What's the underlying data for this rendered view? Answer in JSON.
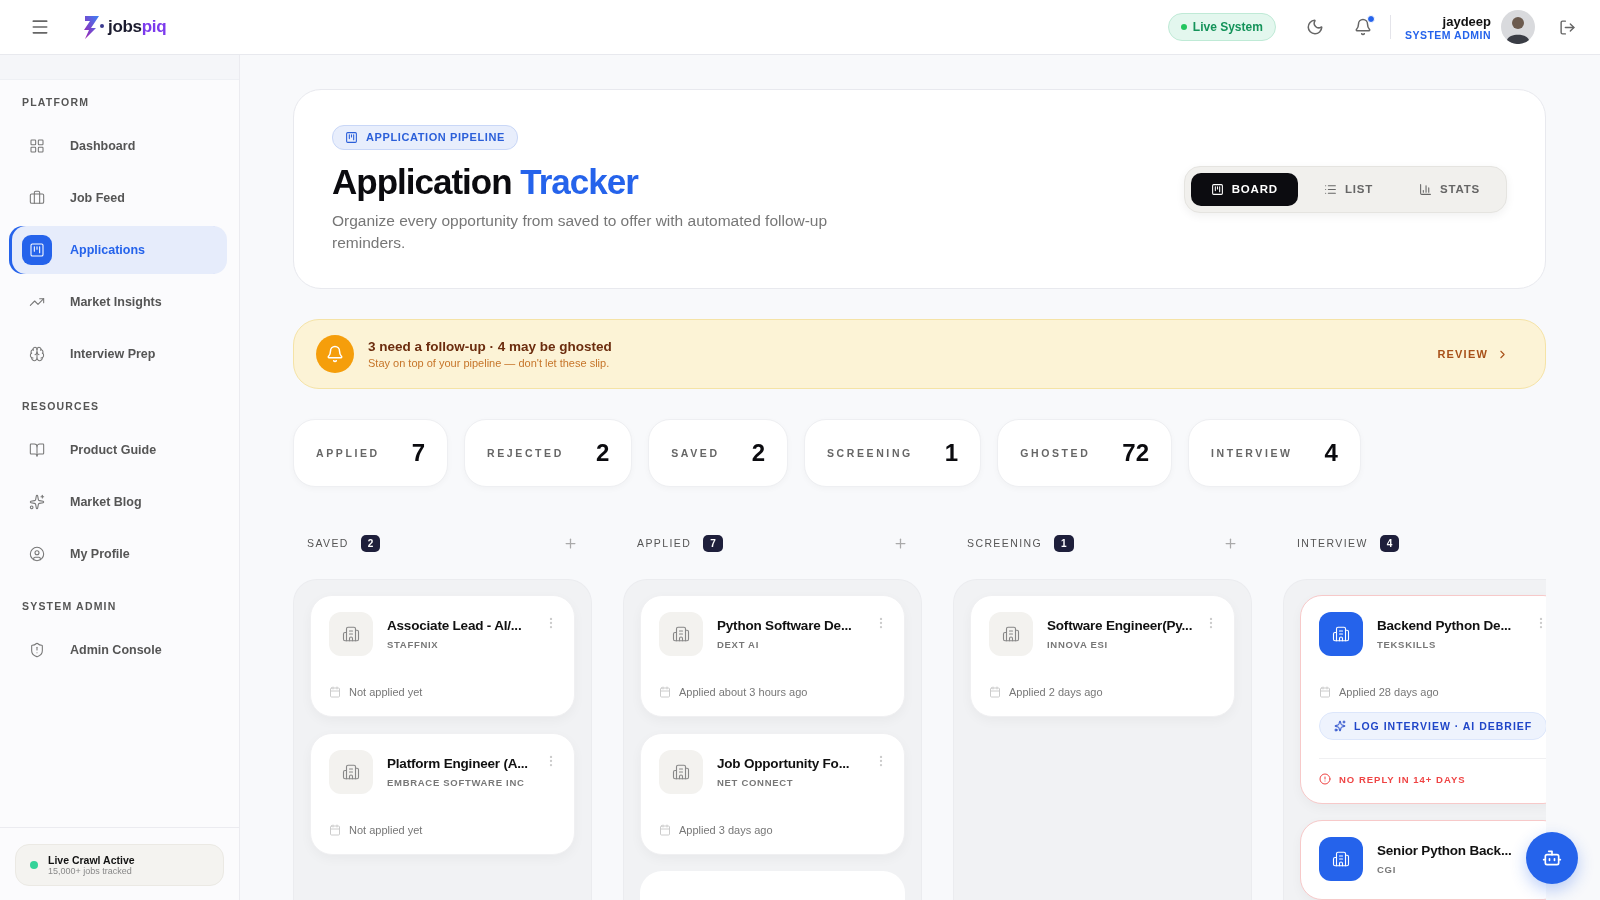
{
  "header": {
    "logo": {
      "text": "jobs",
      "accent": "piq"
    },
    "status": "Live System",
    "notifications": {
      "unread": true
    },
    "user": {
      "name": "jaydeep",
      "role": "SYSTEM ADMIN"
    }
  },
  "sidebar": {
    "sections": [
      {
        "title": "PLATFORM",
        "items": [
          {
            "label": "Dashboard",
            "selected": false
          },
          {
            "label": "Job Feed",
            "selected": false
          },
          {
            "label": "Applications",
            "selected": true
          },
          {
            "label": "Market Insights",
            "selected": false
          },
          {
            "label": "Interview Prep",
            "selected": false
          }
        ]
      },
      {
        "title": "RESOURCES",
        "items": [
          {
            "label": "Product Guide",
            "selected": false
          },
          {
            "label": "Market Blog",
            "selected": false
          },
          {
            "label": "My Profile",
            "selected": false
          }
        ]
      },
      {
        "title": "SYSTEM ADMIN",
        "items": [
          {
            "label": "Admin Console",
            "selected": false
          }
        ]
      }
    ],
    "footer": {
      "title": "Live Crawl Active",
      "subtitle": "15,000+ jobs tracked"
    }
  },
  "hero": {
    "badge": "APPLICATION PIPELINE",
    "title": "Application",
    "title_accent": "Tracker",
    "subtitle": "Organize every opportunity from saved to offer with automated follow-up reminders.",
    "views": [
      {
        "label": "BOARD",
        "selected": true
      },
      {
        "label": "LIST",
        "selected": false
      },
      {
        "label": "STATS",
        "selected": false
      }
    ]
  },
  "alert": {
    "title": "3 need a follow-up · 4 may be ghosted",
    "subtitle": "Stay on top of your pipeline — don't let these slip.",
    "action": "REVIEW"
  },
  "stats": [
    {
      "label": "APPLIED",
      "value": "7"
    },
    {
      "label": "REJECTED",
      "value": "2"
    },
    {
      "label": "SAVED",
      "value": "2"
    },
    {
      "label": "SCREENING",
      "value": "1"
    },
    {
      "label": "GHOSTED",
      "value": "72"
    },
    {
      "label": "INTERVIEW",
      "value": "4"
    }
  ],
  "board": {
    "columns": [
      {
        "title": "SAVED",
        "count": "2",
        "addable": true,
        "cards": [
          {
            "title": "Associate Lead - AI/...",
            "company": "STAFFNIX",
            "date": "Not applied yet",
            "stale": false
          },
          {
            "title": "Platform Engineer (A...",
            "company": "EMBRACE SOFTWARE INC",
            "date": "Not applied yet",
            "stale": false
          }
        ]
      },
      {
        "title": "APPLIED",
        "count": "7",
        "addable": true,
        "cards": [
          {
            "title": "Python Software De...",
            "company": "DEXT AI",
            "date": "Applied about 3 hours ago",
            "stale": false
          },
          {
            "title": "Job Opportunity Fo...",
            "company": "NET CONNECT",
            "date": "Applied 3 days ago",
            "stale": false
          },
          {
            "kind": "hidden"
          }
        ]
      },
      {
        "title": "SCREENING",
        "count": "1",
        "addable": true,
        "cards": [
          {
            "title": "Software Engineer(Py...",
            "company": "INNOVA ESI",
            "date": "Applied 2 days ago",
            "stale": false
          }
        ]
      },
      {
        "title": "INTERVIEW",
        "count": "4",
        "addable": false,
        "cards": [
          {
            "title": "Backend Python De...",
            "company": "TEKSKILLS",
            "date": "Applied 28 days ago",
            "stale": true,
            "action": "LOG INTERVIEW · AI DEBRIEF",
            "warning": "NO REPLY IN 14+ DAYS"
          },
          {
            "title": "Senior Python Back...",
            "company": "CGI",
            "stale": true
          }
        ]
      }
    ]
  }
}
